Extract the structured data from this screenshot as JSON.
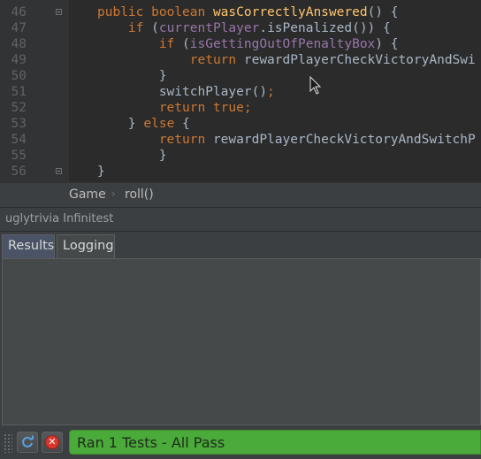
{
  "editor": {
    "lines": [
      {
        "num": "46",
        "indent": 0,
        "fold": true,
        "tokens": [
          {
            "t": "public boolean ",
            "c": "kw"
          },
          {
            "t": "wasCorrectlyAnswered",
            "c": "fn"
          },
          {
            "t": "() {",
            "c": "p"
          }
        ]
      },
      {
        "num": "47",
        "indent": 4,
        "fold": false,
        "tokens": [
          {
            "t": "if ",
            "c": "kw"
          },
          {
            "t": "(",
            "c": "p"
          },
          {
            "t": "currentPlayer",
            "c": "fld"
          },
          {
            "t": ".isPenalized()) {",
            "c": "p"
          }
        ]
      },
      {
        "num": "48",
        "indent": 8,
        "fold": false,
        "tokens": [
          {
            "t": "if ",
            "c": "kw"
          },
          {
            "t": "(",
            "c": "p"
          },
          {
            "t": "isGettingOutOfPenaltyBox",
            "c": "fld"
          },
          {
            "t": ") {",
            "c": "p"
          }
        ]
      },
      {
        "num": "49",
        "indent": 12,
        "fold": false,
        "tokens": [
          {
            "t": "return ",
            "c": "kw"
          },
          {
            "t": "rewardPlayerCheckVictoryAndSwi",
            "c": "p"
          }
        ]
      },
      {
        "num": "50",
        "indent": 8,
        "fold": false,
        "tokens": [
          {
            "t": "}",
            "c": "p"
          }
        ]
      },
      {
        "num": "51",
        "indent": 8,
        "fold": false,
        "tokens": [
          {
            "t": "switchPlayer()",
            "c": "p"
          },
          {
            "t": ";",
            "c": "kw"
          }
        ]
      },
      {
        "num": "52",
        "indent": 8,
        "fold": false,
        "tokens": [
          {
            "t": "return true;",
            "c": "kw"
          }
        ]
      },
      {
        "num": "53",
        "indent": 4,
        "fold": false,
        "tokens": [
          {
            "t": "} ",
            "c": "p"
          },
          {
            "t": "else ",
            "c": "kw"
          },
          {
            "t": "{",
            "c": "p"
          }
        ]
      },
      {
        "num": "54",
        "indent": 8,
        "fold": false,
        "tokens": [
          {
            "t": "return ",
            "c": "kw"
          },
          {
            "t": "rewardPlayerCheckVictoryAndSwitchP",
            "c": "p"
          }
        ]
      },
      {
        "num": "55",
        "indent": 8,
        "fold": false,
        "tokens": [
          {
            "t": "}",
            "c": "p"
          }
        ]
      },
      {
        "num": "56",
        "indent": 0,
        "fold": true,
        "tokens": [
          {
            "t": "}",
            "c": "p"
          }
        ]
      }
    ]
  },
  "breadcrumb": {
    "items": [
      "Game",
      "roll()"
    ],
    "separator": "›"
  },
  "toolwindow": {
    "title": "uglytrivia Infinitest",
    "tabs": [
      {
        "label": "Results",
        "active": true
      },
      {
        "label": "Logging",
        "active": false
      }
    ]
  },
  "status": {
    "message": "Ran 1 Tests - All Pass",
    "icons": [
      "rerun-icon",
      "stop-icon"
    ],
    "pass_color": "#4aaa3a"
  }
}
